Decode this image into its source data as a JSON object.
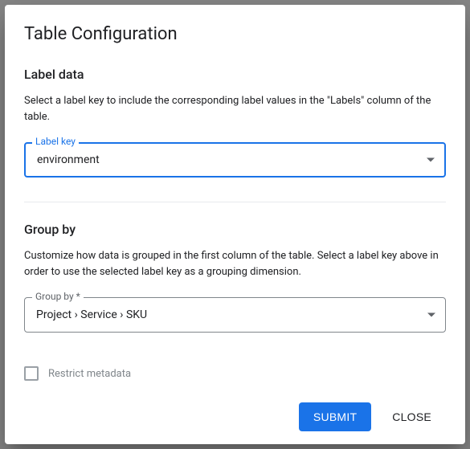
{
  "dialog": {
    "title": "Table Configuration"
  },
  "labelData": {
    "heading": "Label data",
    "description": "Select a label key to include the corresponding label values in the \"Labels\" column of the table.",
    "fieldLabel": "Label key",
    "value": "environment"
  },
  "groupBy": {
    "heading": "Group by",
    "description": "Customize how data is grouped in the first column of the table. Select a label key above in order to use the selected label key as a grouping dimension.",
    "fieldLabel": "Group by *",
    "value": "Project › Service › SKU"
  },
  "restrict": {
    "label": "Restrict metadata",
    "checked": false
  },
  "actions": {
    "submit": "SUBMIT",
    "close": "CLOSE"
  }
}
